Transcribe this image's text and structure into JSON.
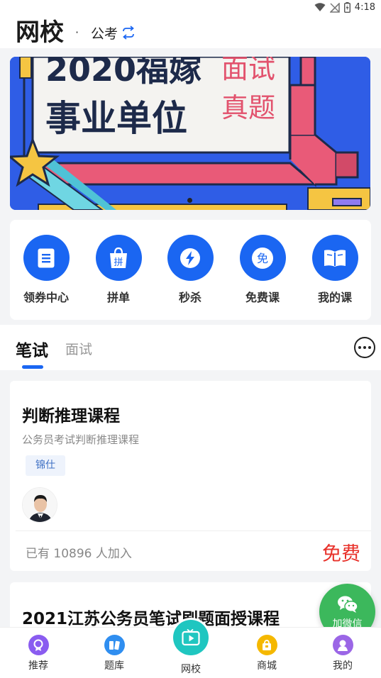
{
  "status_bar": {
    "time": "4:18"
  },
  "header": {
    "title": "网校",
    "separator": "·",
    "exam_type": "公考"
  },
  "banner": {
    "headline_1": "2020福嫁",
    "headline_2": "事业单位",
    "side_1": "面试",
    "side_2": "真题"
  },
  "quick_menu": [
    {
      "label": "领券中心",
      "icon": "coupon-icon"
    },
    {
      "label": "拼单",
      "icon": "group-buy-icon",
      "glyph": "拼"
    },
    {
      "label": "秒杀",
      "icon": "flash-sale-icon"
    },
    {
      "label": "免费课",
      "icon": "free-course-icon",
      "glyph": "免"
    },
    {
      "label": "我的课",
      "icon": "my-course-icon"
    }
  ],
  "tabs": {
    "written": "笔试",
    "interview": "面试"
  },
  "courses": [
    {
      "title": "判断推理课程",
      "subtitle": "公务员考试判断推理课程",
      "tag": "锦仕",
      "joined": "已有 10896 人加入",
      "price": "免费"
    },
    {
      "title": "2021江苏公务员笔试刷题面授课程"
    }
  ],
  "wechat_fab": {
    "label": "加微信"
  },
  "bottom_nav": [
    {
      "label": "推荐",
      "icon": "recommend-icon",
      "color": "#8a5cf0"
    },
    {
      "label": "题库",
      "icon": "question-bank-icon",
      "color": "#2f8ef0"
    },
    {
      "label": "网校",
      "icon": "online-school-icon",
      "color": "#1fc6c0"
    },
    {
      "label": "商城",
      "icon": "mall-icon",
      "color": "#f5b800"
    },
    {
      "label": "我的",
      "icon": "profile-icon",
      "color": "#9b66e6"
    }
  ],
  "colors": {
    "accent": "#1a66f2",
    "price_red": "#e8312a",
    "wechat_green": "#3cb85c"
  }
}
